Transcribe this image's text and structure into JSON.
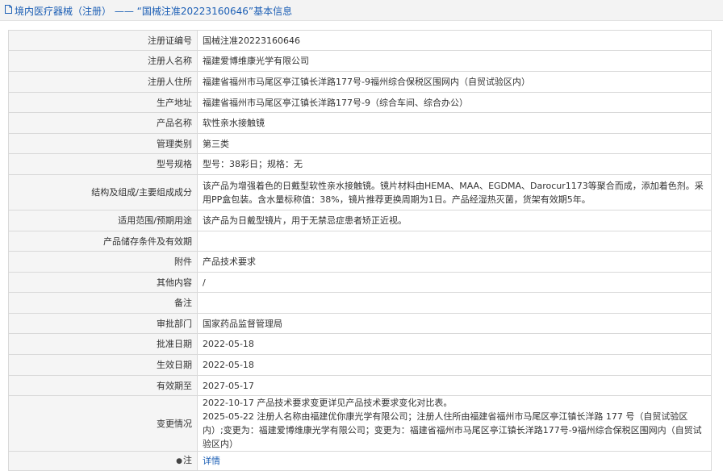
{
  "header": {
    "section": "境内医疗器械（注册）",
    "separator": "——",
    "record_title": "“国械注准20223160646”基本信息"
  },
  "rows": [
    {
      "label": "注册证编号",
      "value": "国械注准20223160646"
    },
    {
      "label": "注册人名称",
      "value": "福建爱博维康光学有限公司"
    },
    {
      "label": "注册人住所",
      "value": "福建省福州市马尾区亭江镇长洋路177号-9福州综合保税区围网内（自贸试验区内）"
    },
    {
      "label": "生产地址",
      "value": "福建省福州市马尾区亭江镇长洋路177号-9（综合车间、综合办公）"
    },
    {
      "label": "产品名称",
      "value": "软性亲水接触镜"
    },
    {
      "label": "管理类别",
      "value": "第三类"
    },
    {
      "label": "型号规格",
      "value": "型号：38彩日；规格：无"
    },
    {
      "label": "结构及组成/主要组成成分",
      "value": "该产品为增强着色的日戴型软性亲水接触镜。镜片材料由HEMA、MAA、EGDMA、Darocur1173等聚合而成，添加着色剂。采用PP盒包装。含水量标称值：38%，镜片推荐更换周期为1日。产品经湿热灭菌，货架有效期5年。"
    },
    {
      "label": "适用范围/预期用途",
      "value": "该产品为日戴型镜片，用于无禁忌症患者矫正近视。"
    },
    {
      "label": "产品储存条件及有效期",
      "value": ""
    },
    {
      "label": "附件",
      "value": "产品技术要求"
    },
    {
      "label": "其他内容",
      "value": "/"
    },
    {
      "label": "备注",
      "value": ""
    },
    {
      "label": "审批部门",
      "value": "国家药品监督管理局"
    },
    {
      "label": "批准日期",
      "value": "2022-05-18"
    },
    {
      "label": "生效日期",
      "value": "2022-05-18"
    },
    {
      "label": "有效期至",
      "value": "2027-05-17"
    },
    {
      "label": "变更情况",
      "value": "2022-10-17 产品技术要求变更详见产品技术要求变化对比表。\n2025-05-22 注册人名称由福建优你康光学有限公司；注册人住所由福建省福州市马尾区亭江镇长洋路 177 号（自贸试验区内）;变更为：福建爱博维康光学有限公司；变更为：福建省福州市马尾区亭江镇长洋路177号-9福州综合保税区围网内（自贸试验区内）"
    }
  ],
  "note": {
    "icon": "pin-icon",
    "label": "注",
    "link_text": "详情"
  },
  "colors": {
    "accent": "#1c5fb5",
    "label_bg": "#f5f5f5",
    "border": "#d9d9d9"
  }
}
